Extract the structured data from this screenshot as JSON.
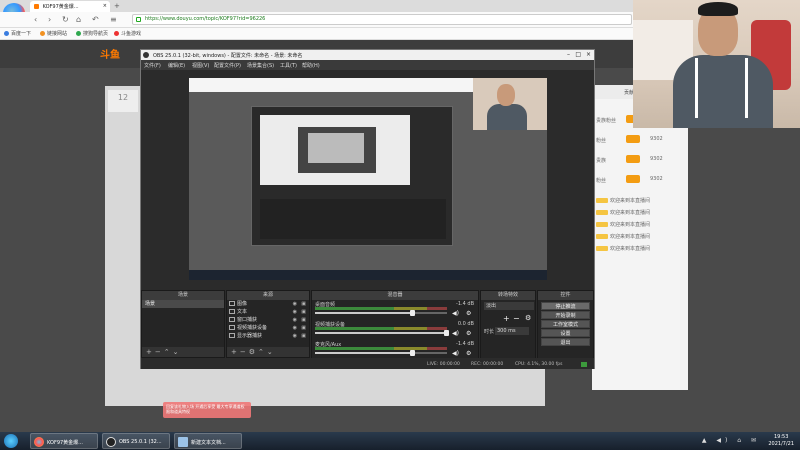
{
  "browser": {
    "logo_label": "立即登录",
    "tab_title": "KOF97黄金爆...",
    "url": "https://www.douyu.com/topic/KOF97?rid=96226",
    "bookmarks": [
      "百度一下",
      "链接网站",
      "搜狗导航页",
      "斗鱼游戏"
    ]
  },
  "site": {
    "logo": "斗鱼",
    "count": "12",
    "danmu_tip": "回复该礼物入场 开通后享受 最大专享通道权限和道具特权"
  },
  "chat": {
    "tabs": [
      "贡献",
      "周榜",
      "粉丝"
    ],
    "action_label": "立即加入粉丝团",
    "ranks": [
      {
        "name": "贵族粉丝",
        "value": "9302"
      },
      {
        "name": "粉丝",
        "value": "9302"
      },
      {
        "name": "贵族",
        "value": "9302"
      },
      {
        "name": "粉丝",
        "value": "9302"
      }
    ],
    "messages": [
      "欢迎来到本直播间",
      "欢迎来到本直播间",
      "欢迎来到本直播间",
      "欢迎来到本直播间",
      "欢迎来到本直播间"
    ]
  },
  "obs": {
    "title": "OBS 25.0.1 (32-bit, windows) - 配置文件: 未命名 - 场景: 未命名",
    "menu": [
      "文件(F)",
      "编辑(E)",
      "视图(V)",
      "配置文件(P)",
      "场景集合(S)",
      "工具(T)",
      "帮助(H)"
    ],
    "docks": {
      "scenes": {
        "title": "场景",
        "items": [
          "场景"
        ]
      },
      "sources": {
        "title": "来源",
        "items": [
          "图像",
          "文本",
          "窗口捕获",
          "视频捕获设备",
          "显示器捕获"
        ]
      },
      "mixer": {
        "title": "混音器",
        "channels": [
          {
            "name": "桌面音频",
            "value": "-1.4 dB"
          },
          {
            "name": "视频捕获设备",
            "value": "0.0 dB"
          },
          {
            "name": "麦克风/Aux",
            "value": "-1.4 dB"
          }
        ]
      },
      "transitions": {
        "title": "转场特效",
        "fade": "淡出",
        "duration_label": "时长",
        "duration": "300 ms"
      },
      "controls": {
        "title": "控件",
        "buttons": [
          "停止推流",
          "开始录制",
          "工作室模式",
          "设置",
          "退出"
        ]
      }
    },
    "status": {
      "live": "LIVE: 00:00:00",
      "rec": "REC: 00:00:00",
      "cpu": "CPU: 4.1%, 30.00 fps"
    }
  },
  "taskbar": {
    "items": [
      "KOF97黄金爆...",
      "OBS 25.0.1 (32...",
      "新建文本文档..."
    ],
    "time": "19:53",
    "date": "2021/7/21"
  },
  "colors": {
    "brand": "#ff7a00",
    "obs_bg": "#2b2b2b",
    "accent_purple": "#b58ad8"
  }
}
